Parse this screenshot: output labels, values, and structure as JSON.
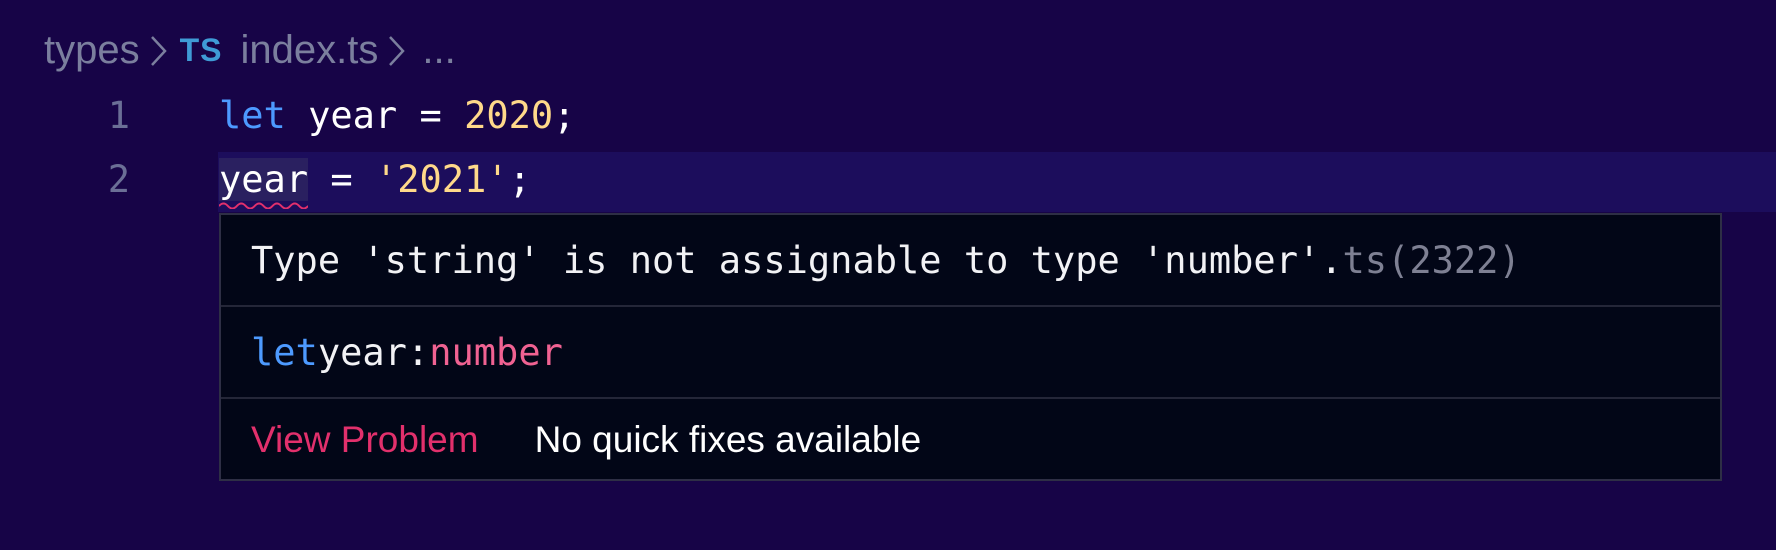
{
  "breadcrumb": {
    "folder": "types",
    "file_badge": "TS",
    "file_name": "index.ts",
    "more": "..."
  },
  "editor": {
    "lines": [
      {
        "number": "1",
        "tokens": {
          "keyword": "let",
          "identifier": "year",
          "operator": "=",
          "value": "2020",
          "terminator": ";"
        }
      },
      {
        "number": "2",
        "tokens": {
          "identifier": "year",
          "operator": "=",
          "value": "'2021'",
          "terminator": ";"
        }
      }
    ]
  },
  "hover": {
    "message": "Type 'string' is not assignable to type 'number'.",
    "error_code": "ts(2322)",
    "signature": {
      "keyword": "let",
      "name": "year:",
      "type": "number"
    },
    "actions": {
      "view_problem": "View Problem",
      "no_fixes": "No quick fixes available"
    }
  },
  "colors": {
    "background": "#170447",
    "keyword": "#4d9aff",
    "literal": "#ffd98a",
    "type": "#f06292",
    "error": "#e2306c",
    "hover_background": "#020617"
  }
}
